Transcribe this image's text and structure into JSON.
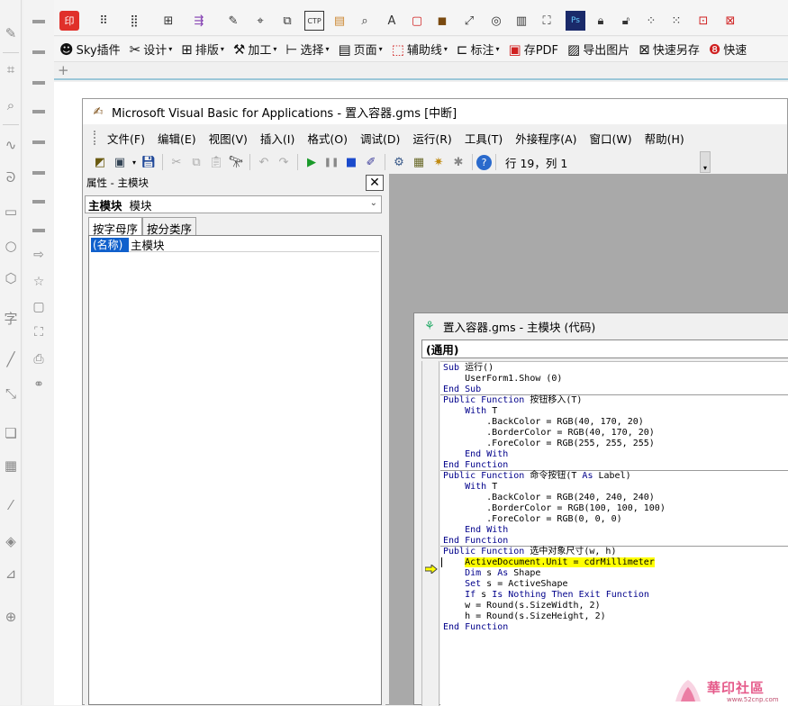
{
  "toolbox": {
    "tools": [
      "freehand-tool-icon",
      "crop-tool-icon",
      "zoom-tool-icon",
      "curve-tool-icon",
      "spiral-tool-icon",
      "rectangle-tool-icon",
      "ellipse-tool-icon",
      "polygon-tool-icon",
      "text-tool-icon",
      "line-tool-icon",
      "connector-tool-icon",
      "shadow-tool-icon",
      "transparency-tool-icon",
      "eyedropper-tool-icon",
      "fill-tool-icon",
      "smart-fill-tool-icon",
      "add-tool-icon"
    ]
  },
  "toolbar2": {
    "items": [
      {
        "label": "Sky插件",
        "icon": "sky-plugin-icon",
        "dropdown": false
      },
      {
        "label": "设计",
        "icon": "design-icon",
        "dropdown": true
      },
      {
        "label": "排版",
        "icon": "layout-icon",
        "dropdown": true
      },
      {
        "label": "加工",
        "icon": "tools-icon",
        "dropdown": true
      },
      {
        "label": "选择",
        "icon": "select-icon",
        "dropdown": true
      },
      {
        "label": "页面",
        "icon": "page-icon",
        "dropdown": true
      },
      {
        "label": "辅助线",
        "icon": "guideline-icon",
        "dropdown": true
      },
      {
        "label": "标注",
        "icon": "annotate-icon",
        "dropdown": true
      },
      {
        "label": "存PDF",
        "icon": "pdf-icon",
        "dropdown": false
      },
      {
        "label": "导出图片",
        "icon": "export-image-icon",
        "dropdown": false
      },
      {
        "label": "快速另存",
        "icon": "quick-save-icon",
        "dropdown": false
      },
      {
        "label": "快速",
        "icon": "quick-icon",
        "dropdown": false
      }
    ]
  },
  "vba": {
    "title": "Microsoft Visual Basic for Applications - 置入容器.gms [中断]",
    "menu": [
      "文件(F)",
      "编辑(E)",
      "视图(V)",
      "插入(I)",
      "格式(O)",
      "调试(D)",
      "运行(R)",
      "工具(T)",
      "外接程序(A)",
      "窗口(W)",
      "帮助(H)"
    ],
    "cursor_position": "行 19，列 1"
  },
  "properties": {
    "title": "属性 - 主模块",
    "object_name": "主模块",
    "object_type": "模块",
    "tabs": [
      "按字母序",
      "按分类序"
    ],
    "rows": [
      {
        "key": "(名称)",
        "value": "主模块"
      }
    ]
  },
  "code_window": {
    "title": "置入容器.gms - 主模块 (代码)",
    "object_combo": "(通用)",
    "lines": [
      "Sub 运行()",
      "    UserForm1.Show (0)",
      "End Sub",
      "Public Function 按钮移入(T)",
      "    With T",
      "        .BackColor = RGB(40, 170, 20)",
      "        .BorderColor = RGB(40, 170, 20)",
      "        .ForeColor = RGB(255, 255, 255)",
      "    End With",
      "End Function",
      "Public Function 命令按钮(T As Label)",
      "    With T",
      "        .BackColor = RGB(240, 240, 240)",
      "        .BorderColor = RGB(100, 100, 100)",
      "        .ForeColor = RGB(0, 0, 0)",
      "    End With",
      "End Function",
      "Public Function 选中对象尺寸(w, h)",
      "    ActiveDocument.Unit = cdrMillimeter",
      "    Dim s As Shape",
      "    Set s = ActiveShape",
      "    If s Is Nothing Then Exit Function",
      "    w = Round(s.SizeWidth, 2)",
      "    h = Round(s.SizeHeight, 2)",
      "End Function"
    ],
    "highlight_color": "#ffff00"
  },
  "watermark": {
    "brand": "華印社區",
    "url": "www.52cnp.com"
  }
}
